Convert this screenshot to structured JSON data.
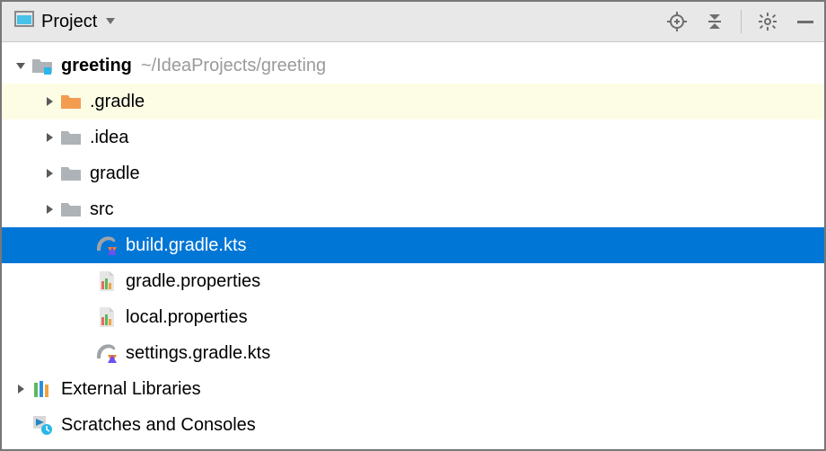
{
  "header": {
    "title": "Project"
  },
  "tree": {
    "root": {
      "name": "greeting",
      "path": "~/IdeaProjects/greeting"
    },
    "dotGradle": ".gradle",
    "dotIdea": ".idea",
    "gradle": "gradle",
    "src": "src",
    "buildGradle": "build.gradle.kts",
    "gradleProps": "gradle.properties",
    "localProps": "local.properties",
    "settingsGradle": "settings.gradle.kts",
    "externalLibs": "External Libraries",
    "scratches": "Scratches and Consoles"
  }
}
